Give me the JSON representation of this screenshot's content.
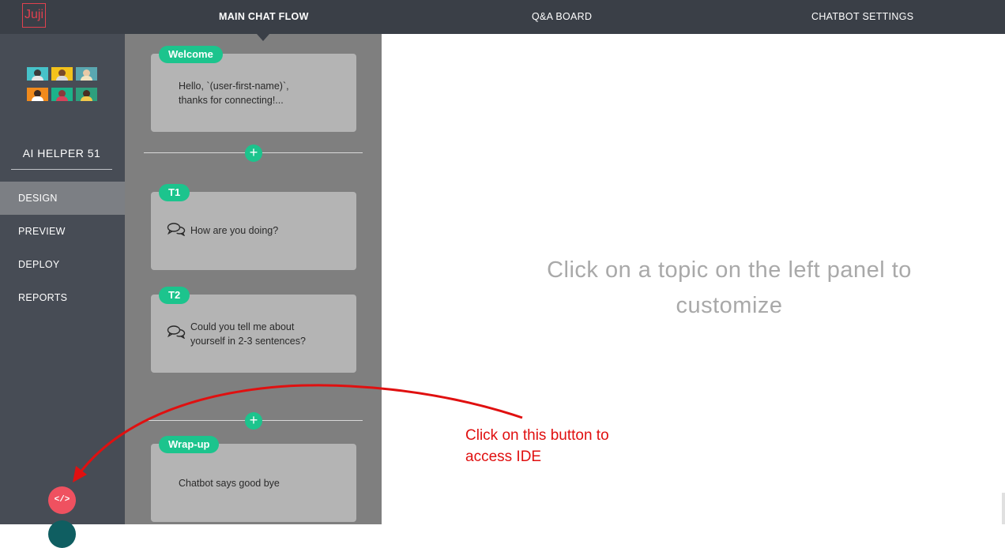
{
  "app": {
    "logo_text": "Juji"
  },
  "tabs": [
    {
      "label": "MAIN CHAT FLOW",
      "active": true
    },
    {
      "label": "Q&A BOARD",
      "active": false
    },
    {
      "label": "CHATBOT SETTINGS",
      "active": false
    }
  ],
  "sidebar": {
    "bot_name": "AI HELPER 51",
    "nav": [
      {
        "label": "DESIGN",
        "active": true
      },
      {
        "label": "PREVIEW",
        "active": false
      },
      {
        "label": "DEPLOY",
        "active": false
      },
      {
        "label": "REPORTS",
        "active": false
      }
    ],
    "ide_button_label": "</>",
    "avatar_colors": [
      "#46c2c9",
      "#f4c21a",
      "#5aa7b0",
      "#f08a1c",
      "#1cb38a",
      "#2e9f7d"
    ]
  },
  "flow": {
    "cards": [
      {
        "tag": "Welcome",
        "text_lines": [
          "Hello, `(user-first-name)`,",
          "thanks for connecting!..."
        ],
        "icon": "none"
      },
      {
        "tag": "T1",
        "text_lines": [
          "How are you doing?"
        ],
        "icon": "chat-bubbles-icon"
      },
      {
        "tag": "T2",
        "text_lines": [
          "Could you tell me about",
          "yourself in 2-3 sentences?"
        ],
        "icon": "chat-bubbles-icon"
      },
      {
        "tag": "Wrap-up",
        "text_lines": [
          "Chatbot says good bye"
        ],
        "icon": "none"
      }
    ],
    "add_button_label": "+"
  },
  "main": {
    "placeholder_lines": [
      "Click on a topic on the left panel to",
      "customize"
    ]
  },
  "annotation": {
    "lines": [
      "Click on this button to",
      "access IDE"
    ],
    "color": "#e01010"
  },
  "colors": {
    "topbar": "#3a3f47",
    "sidebar": "#474c55",
    "flow_panel": "#7f7f7f",
    "card": "#b4b4b4",
    "accent_green": "#1cc48d",
    "ide_button": "#ef5160"
  }
}
